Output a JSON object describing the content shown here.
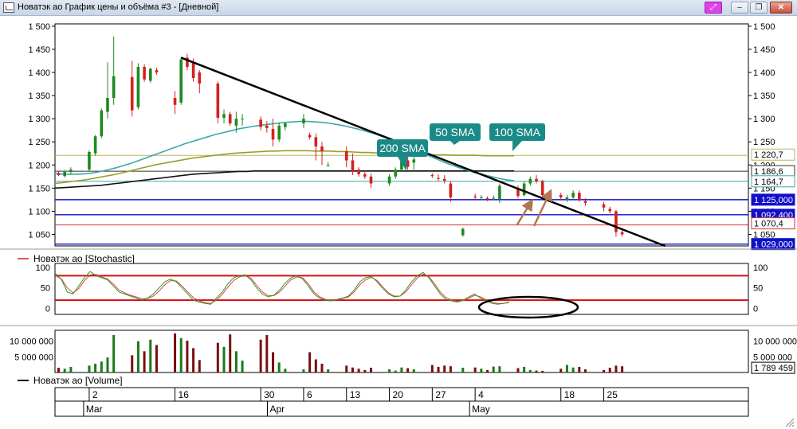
{
  "window": {
    "title": "Новатэк ао График цены и объёма #3 - [Дневной]",
    "buttons": {
      "pin": "⤢",
      "minimize": "–",
      "restore": "❐",
      "close": "✕"
    }
  },
  "chart_data": {
    "type": "candlestick",
    "dates": [
      "2026-02-25",
      "2026-02-26",
      "2026-02-27",
      "2026-03-02",
      "2026-03-03",
      "2026-03-04",
      "2026-03-05",
      "2026-03-06",
      "2026-03-09",
      "2026-03-10",
      "2026-03-11",
      "2026-03-12",
      "2026-03-13",
      "2026-03-16",
      "2026-03-17",
      "2026-03-18",
      "2026-03-19",
      "2026-03-20",
      "2026-03-23",
      "2026-03-24",
      "2026-03-25",
      "2026-03-26",
      "2026-03-27",
      "2026-03-30",
      "2026-03-31",
      "2026-04-01",
      "2026-04-02",
      "2026-04-03",
      "2026-04-06",
      "2026-04-07",
      "2026-04-08",
      "2026-04-09",
      "2026-04-10",
      "2026-04-13",
      "2026-04-14",
      "2026-04-15",
      "2026-04-16",
      "2026-04-17",
      "2026-04-20",
      "2026-04-21",
      "2026-04-22",
      "2026-04-23",
      "2026-04-24",
      "2026-04-27",
      "2026-04-28",
      "2026-04-29",
      "2026-04-30",
      "2026-05-04",
      "2026-05-05",
      "2026-05-06",
      "2026-05-07",
      "2026-05-08",
      "2026-05-11",
      "2026-05-12",
      "2026-05-13",
      "2026-05-14",
      "2026-05-15",
      "2026-05-18",
      "2026-05-19",
      "2026-05-20",
      "2026-05-21",
      "2026-05-22",
      "2026-05-25",
      "2026-05-26",
      "2026-05-27",
      "2026-05-28"
    ],
    "candles": [
      [
        1182,
        1186,
        1176,
        1178
      ],
      [
        1176,
        1189,
        1173,
        1185
      ],
      [
        1185,
        1195,
        1180,
        1190
      ],
      [
        1190,
        1232,
        1185,
        1228
      ],
      [
        1225,
        1265,
        1220,
        1262
      ],
      [
        1262,
        1322,
        1258,
        1318
      ],
      [
        1315,
        1422,
        1300,
        1345
      ],
      [
        1345,
        1478,
        1330,
        1392
      ],
      [
        1390,
        1425,
        1305,
        1318
      ],
      [
        1325,
        1420,
        1320,
        1412
      ],
      [
        1412,
        1418,
        1380,
        1385
      ],
      [
        1382,
        1410,
        1378,
        1408
      ],
      [
        1405,
        1410,
        1395,
        1400
      ],
      [
        1345,
        1360,
        1310,
        1330
      ],
      [
        1335,
        1432,
        1330,
        1428
      ],
      [
        1432,
        1440,
        1405,
        1412
      ],
      [
        1420,
        1430,
        1380,
        1388
      ],
      [
        1400,
        1405,
        1355,
        1376
      ],
      [
        1376,
        1380,
        1290,
        1302
      ],
      [
        1302,
        1320,
        1290,
        1310
      ],
      [
        1310,
        1315,
        1285,
        1290
      ],
      [
        1285,
        1315,
        1270,
        1300
      ],
      [
        1300,
        1310,
        1285,
        1300
      ],
      [
        1298,
        1305,
        1275,
        1282
      ],
      [
        1285,
        1295,
        1270,
        1280
      ],
      [
        1278,
        1300,
        1240,
        1255
      ],
      [
        1255,
        1292,
        1250,
        1285
      ],
      [
        1282,
        1292,
        1275,
        1290
      ],
      [
        1290,
        1310,
        1280,
        1300
      ],
      [
        1265,
        1270,
        1255,
        1260
      ],
      [
        1260,
        1268,
        1210,
        1240
      ],
      [
        1240,
        1250,
        1200,
        1230
      ],
      [
        1200,
        1206,
        1196,
        1200
      ],
      [
        1230,
        1240,
        1195,
        1210
      ],
      [
        1210,
        1225,
        1178,
        1185
      ],
      [
        1190,
        1195,
        1175,
        1180
      ],
      [
        1180,
        1188,
        1170,
        1175
      ],
      [
        1175,
        1182,
        1150,
        1160
      ],
      [
        1160,
        1180,
        1155,
        1175
      ],
      [
        1175,
        1195,
        1170,
        1190
      ],
      [
        1190,
        1220,
        1185,
        1210
      ],
      [
        1210,
        1222,
        1190,
        1196
      ],
      [
        1205,
        1220,
        1185,
        1212
      ],
      [
        1178,
        1182,
        1172,
        1176
      ],
      [
        1172,
        1180,
        1165,
        1170
      ],
      [
        1170,
        1178,
        1160,
        1166
      ],
      [
        1160,
        1165,
        1120,
        1130
      ],
      [
        1132,
        1138,
        1126,
        1130
      ],
      [
        1130,
        1135,
        1125,
        1130
      ],
      [
        1128,
        1132,
        1122,
        1126
      ],
      [
        1128,
        1134,
        1124,
        1129
      ],
      [
        1126,
        1160,
        1118,
        1155
      ],
      [
        1150,
        1156,
        1128,
        1133
      ],
      [
        1135,
        1165,
        1132,
        1160
      ],
      [
        1160,
        1175,
        1155,
        1170
      ],
      [
        1170,
        1178,
        1160,
        1165
      ],
      [
        1165,
        1168,
        1130,
        1135
      ],
      [
        1135,
        1140,
        1125,
        1130
      ],
      [
        1125,
        1135,
        1120,
        1130
      ],
      [
        1130,
        1145,
        1125,
        1140
      ],
      [
        1140,
        1145,
        1120,
        1125
      ],
      [
        1122,
        1128,
        1112,
        1118
      ],
      [
        1115,
        1120,
        1100,
        1108
      ],
      [
        1105,
        1110,
        1095,
        1100
      ],
      [
        1100,
        1102,
        1045,
        1055
      ],
      [
        1055,
        1060,
        1045,
        1050
      ],
      [
        1048,
        1065,
        1045,
        1062
      ]
    ],
    "volumes": [
      1.5,
      1.2,
      1.8,
      2.2,
      2.8,
      3.5,
      4.8,
      12.0,
      5.5,
      10.0,
      6.8,
      10.5,
      8.8,
      12.5,
      11.0,
      10.2,
      7.8,
      4.0,
      9.5,
      8.2,
      12.2,
      6.8,
      3.8,
      10.5,
      12.0,
      6.5,
      3.2,
      1.2,
      1.0,
      6.5,
      4.2,
      2.8,
      1.0,
      2.2,
      1.6,
      1.2,
      0.8,
      1.5,
      1.0,
      0.6,
      1.6,
      1.4,
      1.0,
      2.4,
      1.8,
      2.2,
      2.0,
      1.6,
      1.2,
      0.8,
      1.9,
      2.0,
      1.4,
      1.8,
      0.8,
      0.6,
      0.5,
      1.2,
      2.4,
      1.6,
      1.8,
      1.0,
      0.8,
      1.5,
      2.2,
      2.0,
      1.5
    ],
    "stochastic_k": [
      85,
      70,
      40,
      35,
      55,
      75,
      90,
      80,
      75,
      70,
      55,
      40,
      35,
      30,
      25,
      20,
      25,
      35,
      50,
      65,
      72,
      65,
      50,
      35,
      20,
      15,
      12,
      10,
      25,
      40,
      60,
      75,
      80,
      82,
      70,
      50,
      35,
      28,
      32,
      45,
      62,
      75,
      80,
      72,
      55,
      35,
      25,
      20,
      18,
      22,
      25,
      30,
      45,
      65,
      75,
      78,
      65,
      48,
      35,
      28,
      30,
      45,
      65,
      80,
      88,
      75,
      55,
      35,
      22,
      18,
      15,
      20,
      28,
      35,
      25,
      18,
      12,
      10,
      12,
      15
    ],
    "stochastic_d": [
      80,
      72,
      50,
      38,
      48,
      68,
      82,
      83,
      77,
      72,
      60,
      45,
      38,
      32,
      28,
      23,
      24,
      30,
      42,
      58,
      68,
      67,
      55,
      40,
      26,
      18,
      14,
      12,
      20,
      34,
      52,
      68,
      77,
      80,
      74,
      56,
      40,
      31,
      31,
      40,
      55,
      70,
      77,
      75,
      60,
      40,
      28,
      22,
      20,
      21,
      24,
      28,
      40,
      58,
      70,
      76,
      68,
      52,
      38,
      30,
      30,
      40,
      58,
      74,
      84,
      78,
      60,
      40,
      26,
      20,
      17,
      19,
      25,
      32,
      28,
      21,
      15,
      12,
      12,
      14
    ],
    "sma50": [
      1182,
      1180,
      1180,
      1180,
      1181,
      1183,
      1186,
      1190,
      1194,
      1199,
      1204,
      1210,
      1216,
      1222,
      1228,
      1234,
      1240,
      1246,
      1251,
      1256,
      1261,
      1266,
      1270,
      1274,
      1278,
      1281,
      1284,
      1286,
      1288,
      1290,
      1292,
      1293,
      1294,
      1294,
      1293,
      1292,
      1290,
      1287,
      1284,
      1280,
      1276,
      1271,
      1266,
      1260,
      1254,
      1247,
      1240,
      1233,
      1226,
      1219,
      1212,
      1205,
      1199,
      1193,
      1188,
      1183,
      1179,
      1175,
      1171,
      1168,
      1166
    ],
    "sma100": [
      1160,
      1162,
      1164,
      1166,
      1168,
      1171,
      1174,
      1177,
      1180,
      1184,
      1188,
      1192,
      1196,
      1200,
      1203,
      1206,
      1209,
      1212,
      1215,
      1217,
      1219,
      1221,
      1223,
      1225,
      1226,
      1227,
      1228,
      1229,
      1230,
      1230,
      1231,
      1231,
      1231,
      1231,
      1230,
      1230,
      1230,
      1229,
      1229,
      1228,
      1227,
      1227,
      1226,
      1225,
      1225,
      1224,
      1224,
      1223,
      1223,
      1222,
      1222,
      1222,
      1221,
      1221,
      1221,
      1221,
      1220,
      1220,
      1220,
      1220,
      1220
    ],
    "sma200": [
      1150,
      1151,
      1152,
      1153,
      1154,
      1155,
      1156,
      1158,
      1160,
      1162,
      1164,
      1166,
      1168,
      1170,
      1172,
      1174,
      1176,
      1178,
      1180,
      1181,
      1182,
      1183,
      1184,
      1185,
      1186,
      1186,
      1187,
      1187,
      1187,
      1187,
      1187,
      1187,
      1187,
      1187,
      1187,
      1187,
      1187,
      1187,
      1187,
      1187,
      1187,
      1187,
      1187,
      1187,
      1187,
      1187,
      1187,
      1187,
      1187,
      1187,
      1187,
      1187,
      1187,
      1187,
      1187,
      1187,
      1187,
      1187,
      1187,
      1187,
      1187
    ],
    "trendline": {
      "from": [
        "2026-03-17",
        1432
      ],
      "to": [
        "2026-06-04",
        1025
      ]
    },
    "price_ylim": [
      1025,
      1505
    ],
    "price_ticks": [
      "1 500",
      "1 450",
      "1 400",
      "1 350",
      "1 300",
      "1 250",
      "1 200",
      "1 150",
      "1 100",
      "1 050"
    ],
    "price_tick_values": [
      1500,
      1450,
      1400,
      1350,
      1300,
      1250,
      1200,
      1150,
      1100,
      1050
    ],
    "horizontal_levels": [
      {
        "value": 1220.7,
        "label": "1 220,7",
        "color": "#b5b563",
        "style": "outline"
      },
      {
        "value": 1186.6,
        "label": "1 186,6",
        "color": "#333333",
        "style": "outline"
      },
      {
        "value": 1164.7,
        "label": "1 164,7",
        "color": "#3aa8a8",
        "style": "outline"
      },
      {
        "value": 1125.0,
        "label": "1 125,000",
        "color": "#1010c8",
        "style": "filled"
      },
      {
        "value": 1092.4,
        "label": "1 092,400",
        "color": "#1010c8",
        "style": "filled"
      },
      {
        "value": 1070.4,
        "label": "1 070,4",
        "color": "#cc3333",
        "style": "outline"
      },
      {
        "value": 1029.0,
        "label": "1 029,000",
        "color": "#1010c8",
        "style": "filled"
      }
    ],
    "hidden_label": "1 050",
    "callouts": [
      "200 SMA",
      "50 SMA",
      "100 SMA"
    ],
    "stochastic": {
      "legend": "Новатэк ао [Stochastic]",
      "ticks": [
        "100",
        "50",
        "0"
      ],
      "tick_values": [
        100,
        50,
        0
      ],
      "ylim": [
        -15,
        110
      ],
      "upper": 80,
      "lower": 20
    },
    "volume": {
      "legend": "Новатэк ао [Volume]",
      "ticks": [
        "10 000 000",
        "5 000 000"
      ],
      "tick_values": [
        10,
        5
      ],
      "unit": 1000000,
      "ylim": [
        0,
        13.5
      ],
      "last_label": "1 789 459"
    },
    "x_ticks": [
      "2",
      "16",
      "30",
      "6",
      "13",
      "20",
      "27",
      "4",
      "18",
      "25"
    ],
    "x_tick_dates": [
      "2026-03-02",
      "2026-03-16",
      "2026-03-30",
      "2026-04-06",
      "2026-04-13",
      "2026-04-20",
      "2026-04-27",
      "2026-05-04",
      "2026-05-18",
      "2026-05-25"
    ],
    "months": [
      "Mar",
      "Apr",
      "May"
    ],
    "month_dates": [
      "2026-03-02",
      "2026-04-01",
      "2026-05-04"
    ],
    "colors": {
      "up": "#1e8a1e",
      "down": "#d42020",
      "vol_up": "#1a7a1a",
      "vol_down": "#7a1010",
      "sma50": "#3aa8a8",
      "sma100": "#9c9c2c",
      "sma200": "#111111",
      "callout": "#1a8a88",
      "arrows": "#b07850"
    }
  }
}
